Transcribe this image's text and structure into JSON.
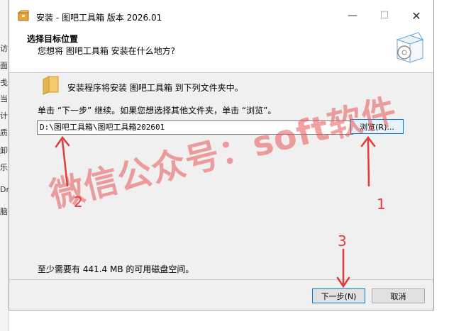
{
  "background_window": {
    "fragments": [
      "访",
      "面",
      "戋",
      "当",
      "计",
      "质",
      "卸",
      "乐",
      "Dr",
      "脑"
    ]
  },
  "window": {
    "title": "安装 - 图吧工具箱 版本 2026.01",
    "minimize_label": "—",
    "maximize_label": "☐",
    "close_label": "✕"
  },
  "header": {
    "title": "选择目标位置",
    "subtitle": "您想将 图吧工具箱 安装在什么地方?"
  },
  "body": {
    "folder_text": "安装程序将安装 图吧工具箱 到下列文件夹中。",
    "instruction": "单击 “下一步” 继续。如果您想选择其他文件夹，单击 “浏览”。",
    "path_value": "D:\\图吧工具箱\\图吧工具箱202601",
    "browse_label": "浏览(R)...",
    "space_text": "至少需要有 441.4 MB 的可用磁盘空间。"
  },
  "footer": {
    "next_label": "下一步(N)",
    "cancel_label": "取消"
  },
  "annotations": {
    "watermark": "微信公众号：soft软件",
    "label_1": "1",
    "label_2": "2",
    "label_3": "3",
    "color": "#e23b3b"
  },
  "icons": {
    "app": "installer-app-icon",
    "header": "software-box-icon",
    "folder": "folder-icon"
  }
}
